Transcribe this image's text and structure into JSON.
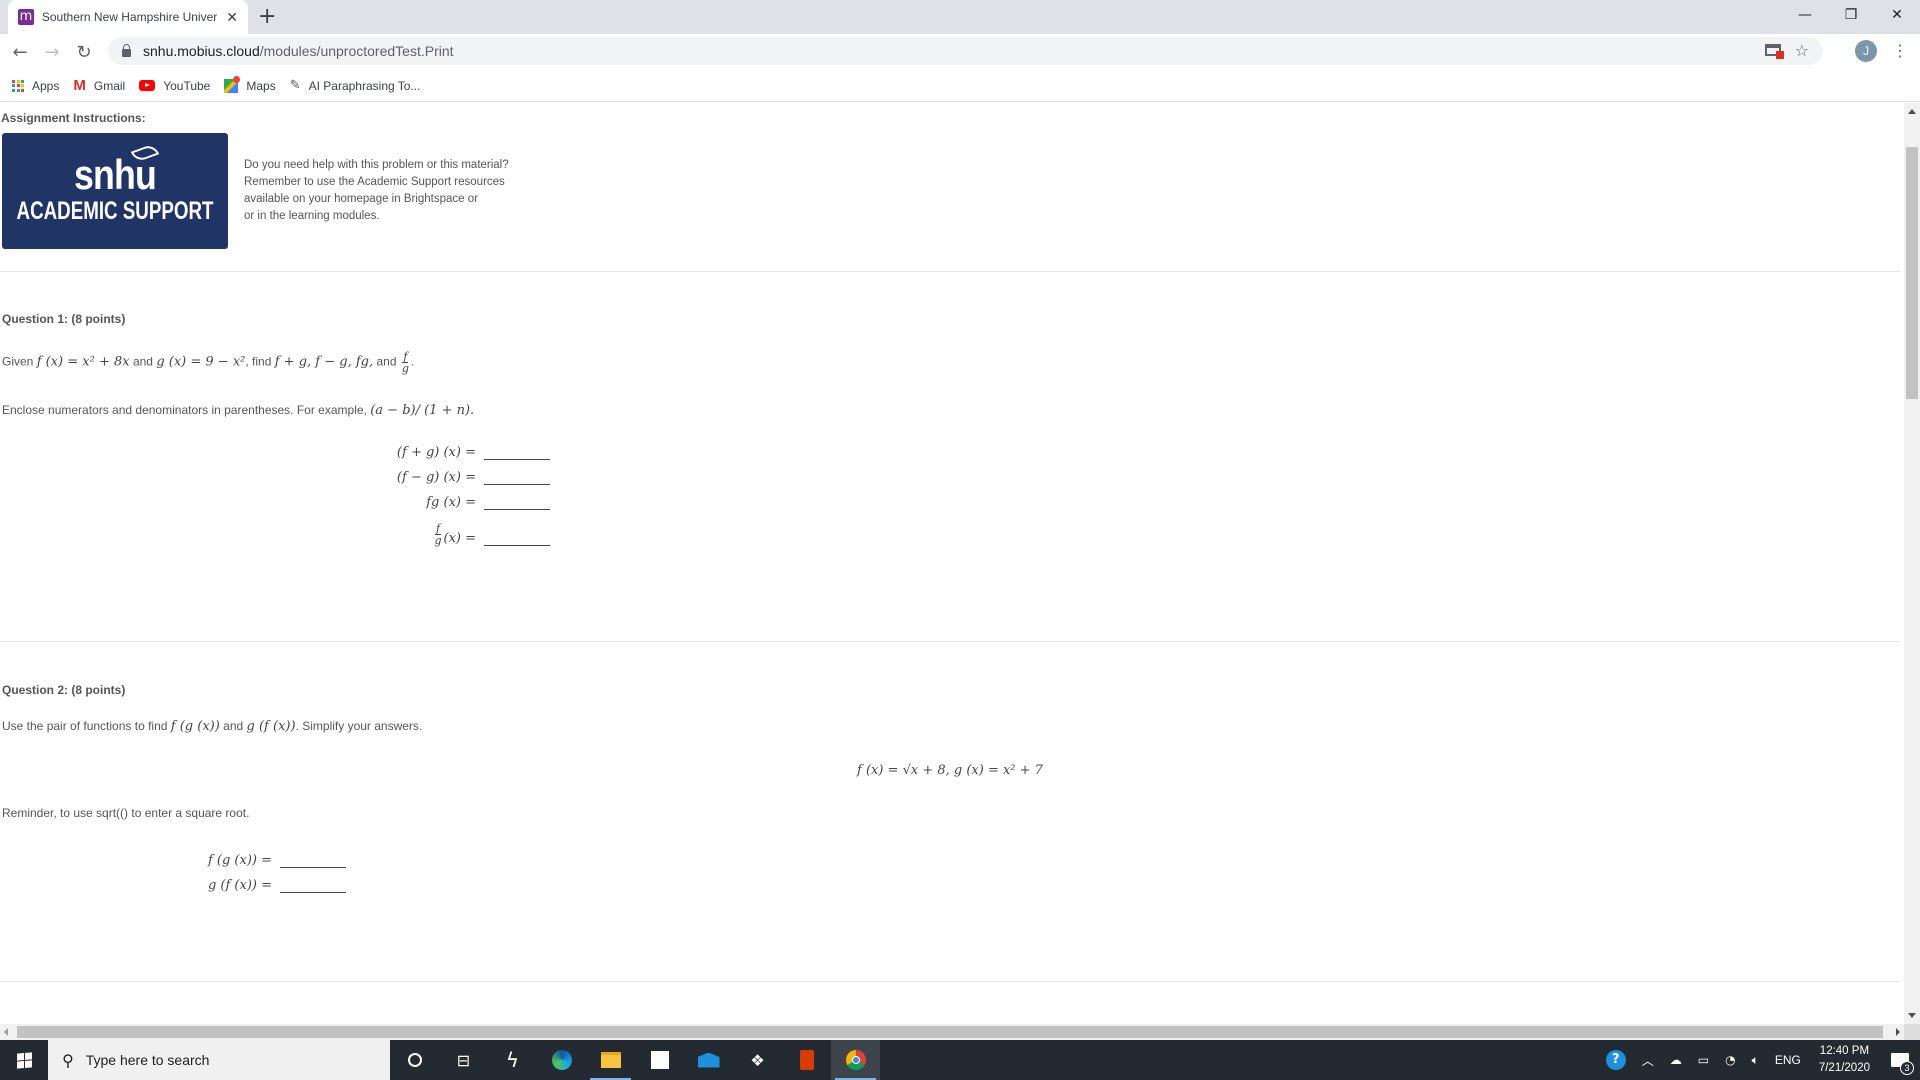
{
  "browser": {
    "tab": {
      "title": "Southern New Hampshire Univer",
      "favicon": "m",
      "favicon_color": "#7b2c8f",
      "close": "✕"
    },
    "new_tab": "+",
    "window_controls": {
      "minimize": "—",
      "restore": "❐",
      "close": "✕"
    },
    "nav": {
      "back": "←",
      "forward": "→",
      "reload": "↻"
    },
    "url_host": "snhu.mobius.cloud",
    "url_path": "/modules/unproctoredTest.Print",
    "profile_initial": "J",
    "menu": "⋮",
    "bookmarks": [
      {
        "label": "Apps",
        "icon": "apps-grid-icon"
      },
      {
        "label": "Gmail",
        "icon": "gmail-icon"
      },
      {
        "label": "YouTube",
        "icon": "youtube-icon"
      },
      {
        "label": "Maps",
        "icon": "maps-icon"
      },
      {
        "label": "AI Paraphrasing To...",
        "icon": "quill-icon"
      }
    ]
  },
  "page": {
    "instructions_heading": "Assignment Instructions:",
    "banner": {
      "brand": "snhu",
      "subtitle": "ACADEMIC SUPPORT",
      "bg_color": "#213466"
    },
    "help_text": [
      "Do you need help with this problem or this material?",
      "Remember to use the Academic Support resources",
      "available on your homepage in Brightspace or",
      "or in the learning modules."
    ],
    "q1": {
      "title": "Question 1: (8 points)",
      "given_prefix": "Given",
      "f_def": "f (x) = x² + 8x",
      "and": "and",
      "g_def": "g (x) = 9 − x²",
      "find_text": ", find",
      "find_list": "f + g, f − g, fg,",
      "and2": "and",
      "frac_num": "f",
      "frac_den": "g",
      "enclose_text": "Enclose numerators and denominators in parentheses. For example,",
      "example": "(a − b)/ (1 + n).",
      "answers": [
        {
          "label": "(f + g) (x) =",
          "value": ""
        },
        {
          "label": "(f − g) (x) =",
          "value": ""
        },
        {
          "label": "fg (x) =",
          "value": ""
        },
        {
          "label": "(x) =",
          "value": "",
          "frac_num": "f",
          "frac_den": "g"
        }
      ]
    },
    "q2": {
      "title": "Question 2: (8 points)",
      "prompt_prefix": "Use the pair of functions to find",
      "fg": "f (g (x))",
      "and": "and",
      "gf": "g (f (x))",
      "prompt_suffix": ". Simplify your answers.",
      "functions": "f (x) = √x + 8, g (x) = x² + 7",
      "reminder": "Reminder, to use sqrt(() to enter a square root.",
      "answers": [
        {
          "label": "f (g (x)) =",
          "value": ""
        },
        {
          "label": "g (f (x)) =",
          "value": ""
        }
      ]
    }
  },
  "taskbar": {
    "search_placeholder": "Type here to search",
    "apps": [
      "cortana-icon",
      "task-view-icon",
      "app-bolt-icon",
      "edge-icon",
      "file-explorer-icon",
      "store-icon",
      "mail-icon",
      "dropbox-icon",
      "office-icon",
      "chrome-icon"
    ],
    "tray": {
      "language": "ENG",
      "time": "12:40 PM",
      "date": "7/21/2020",
      "notifications": "3"
    }
  }
}
